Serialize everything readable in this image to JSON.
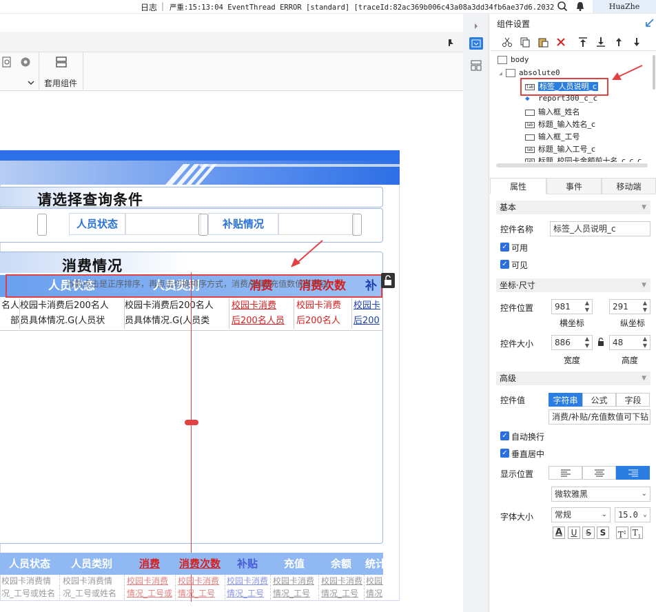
{
  "topbar": {
    "log_label": "日志",
    "error_text": "严重:15:13:04 EventThread ERROR [standard] [traceId:82ac369b006c43a08a3dd34fb6ae37d6.20324...",
    "user": "HuaZhe"
  },
  "toolbar": {
    "apply_component": "套用组件"
  },
  "report": {
    "query_title": "请选择查询条件",
    "filter_staff_status": "人员状态",
    "filter_subsidy": "补贴情况",
    "consume_title": "消费情况",
    "overlay_text": "当前点击是正序排序，再点击切换排序方式，消费/补贴/充值数值可下钻",
    "headers": [
      "人员状态",
      "人员类别",
      "消费",
      "消费次数",
      "补"
    ],
    "row_cells": [
      {
        "l1": "名人",
        "l2": "部"
      },
      {
        "l1": "校园卡消费后200名人",
        "l2": "员具体情况.G(人员状"
      },
      {
        "l1": "校园卡消费后200名人",
        "l2": "员具体情况.G(人员类"
      },
      {
        "l1": "校园卡消费",
        "l2": "后200名人员"
      },
      {
        "l1": "校园卡消费",
        "l2": "后200名人"
      },
      {
        "l1": "校园卡",
        "l2": "后200"
      }
    ],
    "footer_headers": [
      "人员状态",
      "人员类别",
      "消费",
      "消费次数",
      "补贴",
      "充值",
      "余额",
      "统计"
    ],
    "footer_cells": [
      {
        "l1": "校园卡消费情",
        "l2": "况_工号或姓名"
      },
      {
        "l1": "校园卡消费情",
        "l2": "况_工号或姓名"
      },
      {
        "l1": "校园卡消费",
        "l2": "情况_工号或"
      },
      {
        "l1": "校园卡消费",
        "l2": "情况_工号"
      },
      {
        "l1": "校园卡消费",
        "l2": "情况_工号"
      },
      {
        "l1": "校园卡消费",
        "l2": "情况_工号"
      },
      {
        "l1": "校园卡消费",
        "l2": "情况_工号"
      },
      {
        "l1": "校园卡",
        "l2": "情况"
      }
    ]
  },
  "panel": {
    "title": "组件设置",
    "tree": [
      {
        "label": "body"
      },
      {
        "label": "absolute0"
      },
      {
        "label": "标签_人员说明_c"
      },
      {
        "label": "report300_c_c"
      },
      {
        "label": "输入框_姓名"
      },
      {
        "label": "标题_输入姓名_c"
      },
      {
        "label": "输入框_工号"
      },
      {
        "label": "标题_输入工号_c"
      },
      {
        "label": "标题_校园卡金额前十名_c_c_c"
      }
    ],
    "tabs": [
      "属性",
      "事件",
      "移动端"
    ],
    "basic_section": "基本",
    "name_label": "控件名称",
    "name_value": "标签_人员说明_c",
    "enabled_label": "可用",
    "visible_label": "可见",
    "coord_section": "坐标·尺寸",
    "position_label": "控件位置",
    "pos_x": "981",
    "pos_y": "291",
    "x_caption": "横坐标",
    "y_caption": "纵坐标",
    "size_label": "控件大小",
    "width": "886",
    "height": "48",
    "w_caption": "宽度",
    "h_caption": "高度",
    "advanced_section": "高级",
    "value_label": "控件值",
    "value_types": [
      "字符串",
      "公式",
      "字段"
    ],
    "value_text": "消费/补贴/充值数值可下钻",
    "auto_wrap": "自动换行",
    "vcenter": "垂直居中",
    "align_label": "显示位置",
    "font_family": "微软雅黑",
    "font_size_label": "字体大小",
    "font_style": "常规",
    "font_size": "15.0"
  }
}
